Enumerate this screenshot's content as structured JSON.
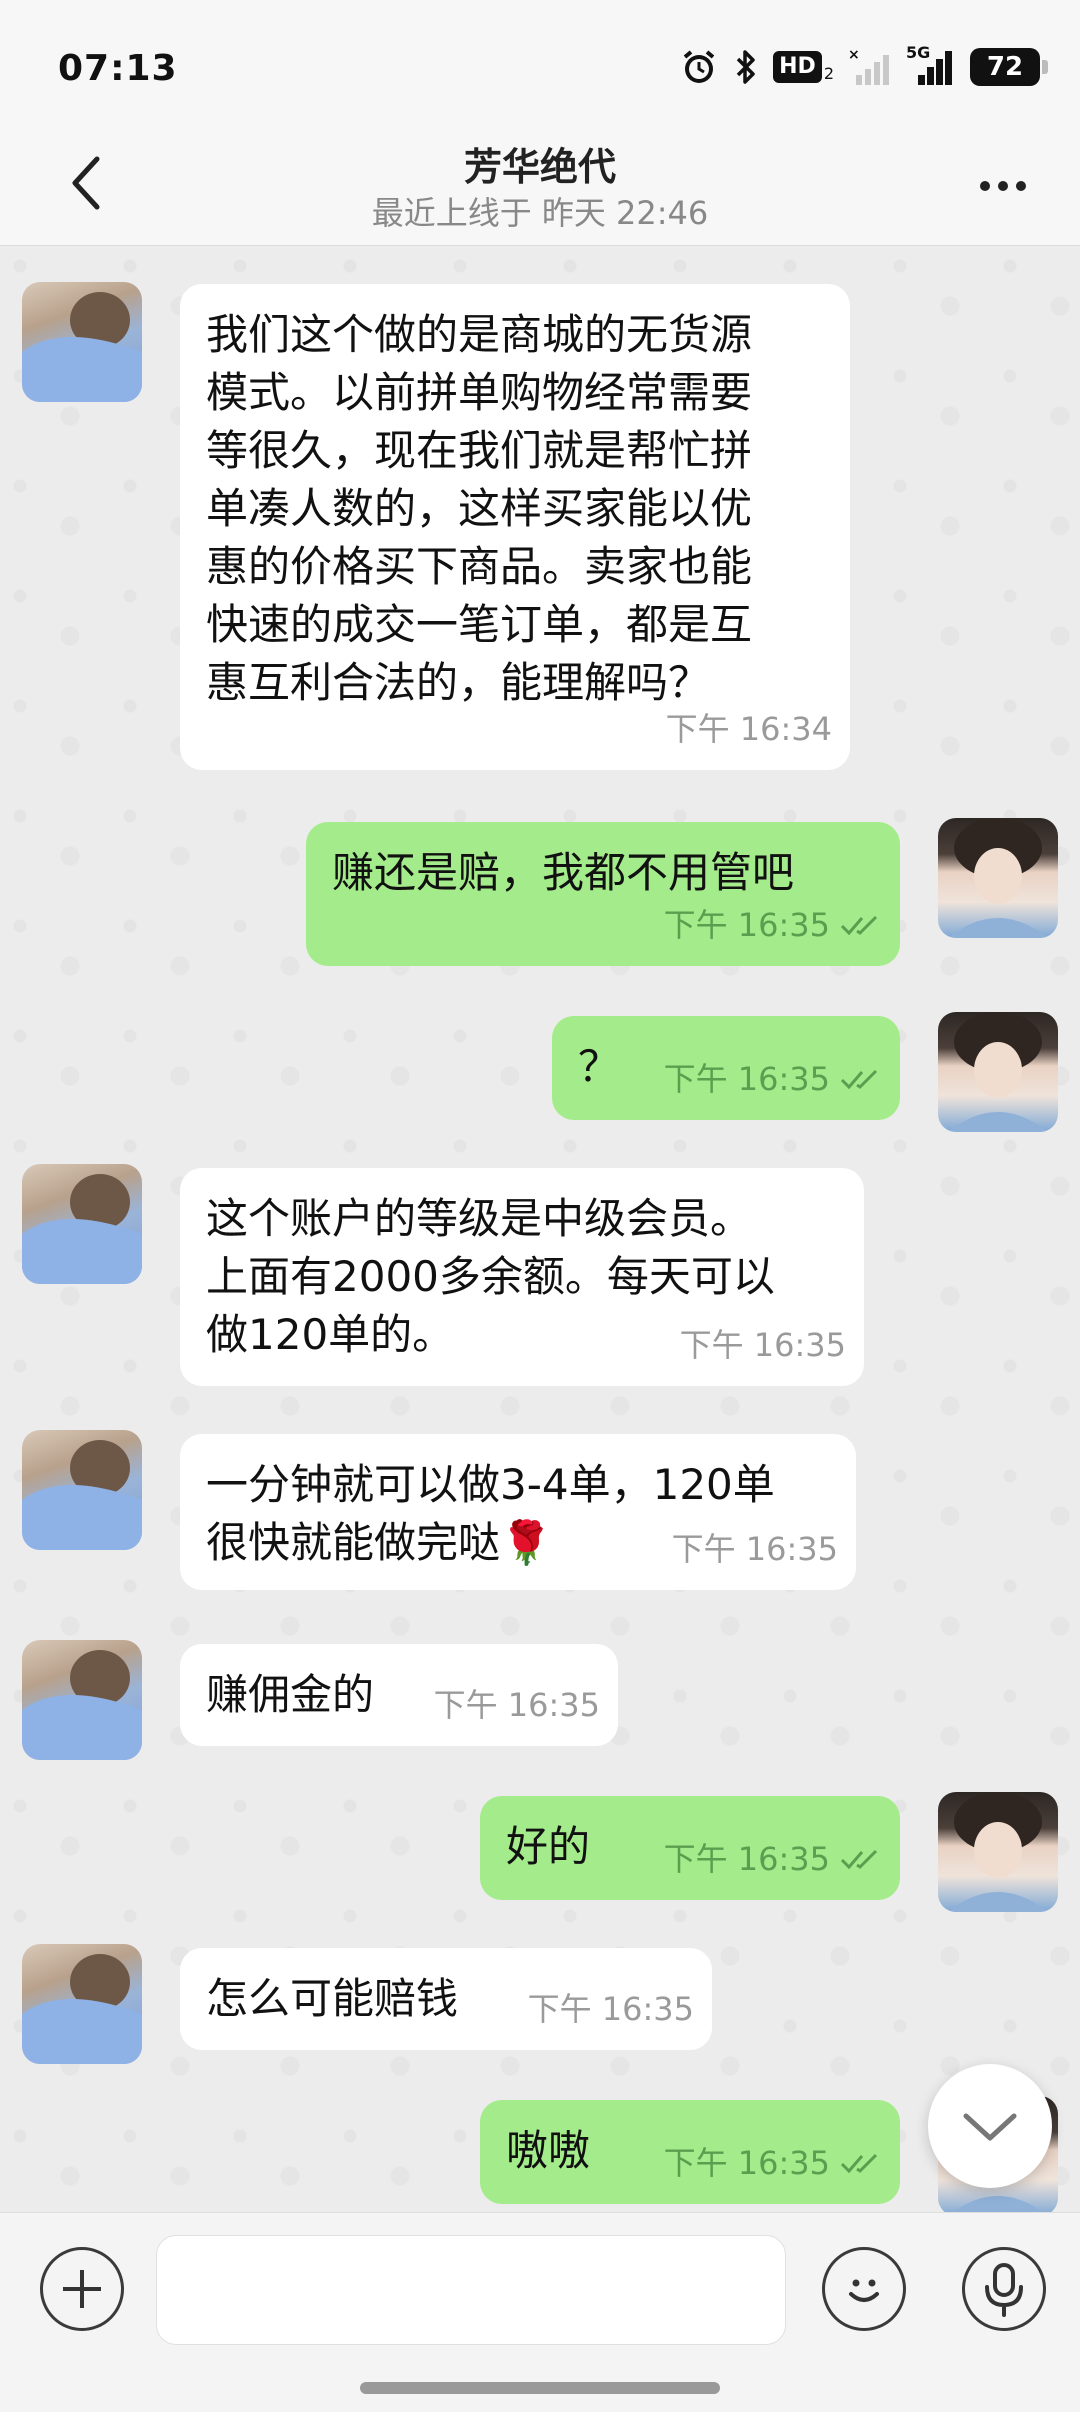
{
  "status_bar": {
    "time": "07:13",
    "hd_label": "HD",
    "hd_sub": "2",
    "network_label": "5G",
    "battery": "72",
    "icons": [
      "alarm-icon",
      "bluetooth-icon",
      "hd-voice-icon",
      "signal-icon",
      "signal-5g-icon",
      "battery-icon"
    ]
  },
  "header": {
    "title": "芳华绝代",
    "subtitle": "最近上线于 昨天 22:46",
    "back_icon": "chevron-left-icon",
    "more_icon": "more-dots-icon"
  },
  "messages": [
    {
      "side": "in",
      "text": "我们这个做的是商城的无货源\n模式。以前拼单购物经常需要\n等很久，现在我们就是帮忙拼\n单凑人数的，这样买家能以优\n惠的价格买下商品。卖家也能\n快速的成交一笔订单，都是互\n惠互利合法的，能理解吗？",
      "time": "下午  16:34"
    },
    {
      "side": "out",
      "text": "赚还是赔，我都不用管吧",
      "time": "下午  16:35",
      "read": true
    },
    {
      "side": "out",
      "text": "？",
      "time": "下午  16:35",
      "read": true
    },
    {
      "side": "in",
      "text": "这个账户的等级是中级会员。\n上面有2000多余额。每天可以\n做120单的。",
      "time": "下午  16:35"
    },
    {
      "side": "in",
      "text": "一分钟就可以做3-4单，120单\n很快就能做完哒🌹",
      "time": "下午  16:35"
    },
    {
      "side": "in",
      "text": "赚佣金的",
      "time": "下午  16:35"
    },
    {
      "side": "out",
      "text": "好的",
      "time": "下午  16:35",
      "read": true
    },
    {
      "side": "in",
      "text": "怎么可能赔钱",
      "time": "下午  16:35"
    },
    {
      "side": "out",
      "text": "嗷嗷",
      "time": "下午  16:35",
      "read": true
    }
  ],
  "input": {
    "placeholder": "",
    "value": ""
  },
  "colors": {
    "outgoing_bubble": "#a4ec8b",
    "incoming_bubble": "#ffffff",
    "chat_background": "#ececec",
    "read_ticks": "#5c9e4f"
  }
}
